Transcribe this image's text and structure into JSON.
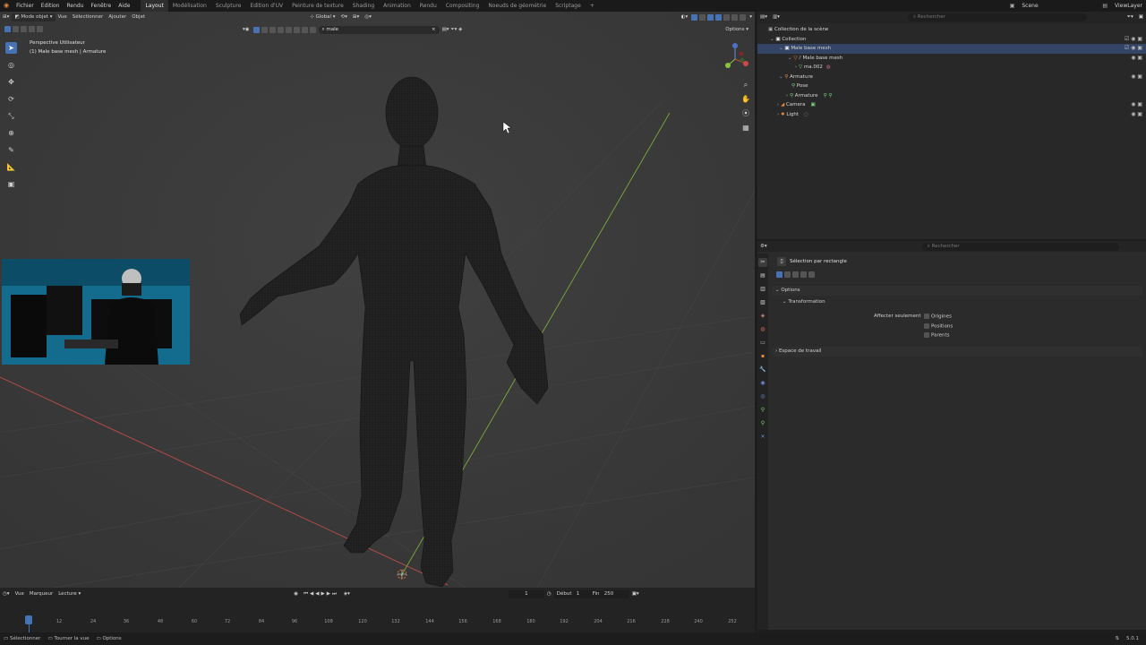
{
  "menu": {
    "items": [
      "Fichier",
      "Edition",
      "Rendu",
      "Fenêtre",
      "Aide"
    ],
    "workspaces": [
      "Layout",
      "Modélisation",
      "Sculpture",
      "Edition d'UV",
      "Peinture de texture",
      "Shading",
      "Animation",
      "Rendu",
      "Compositing",
      "Noeuds de géométrie",
      "Scriptage"
    ],
    "active_workspace": "Layout",
    "scene": "Scene",
    "view_layer": "ViewLayer"
  },
  "viewport": {
    "mode": "Mode objet",
    "menus": [
      "Vue",
      "Sélectionner",
      "Ajouter",
      "Objet"
    ],
    "orientation": "Global",
    "filter_value": "male",
    "options_label": "Options",
    "overlay_title": "Perspective Utilisateur",
    "overlay_subtitle": "(1) Male base mesh | Armature",
    "accent": "#4772b3",
    "x_axis_color": "#c94a4a",
    "y_axis_color": "#8cc43a"
  },
  "outliner": {
    "search_placeholder": "Rechercher",
    "rows": [
      {
        "label": "Collection de la scène"
      },
      {
        "label": "Collection"
      },
      {
        "label": "Male base mesh"
      },
      {
        "label": "Male base mesh"
      },
      {
        "label": "ma.002"
      },
      {
        "label": "Armature"
      },
      {
        "label": "Pose"
      },
      {
        "label": "Armature"
      },
      {
        "label": "Camera"
      },
      {
        "label": "Light"
      }
    ]
  },
  "properties": {
    "search_placeholder": "Rechercher",
    "tool_name": "Sélection par rectangle",
    "options_panel": "Options",
    "transform_panel": "Transformation",
    "affect_only_label": "Affecter seulement",
    "checkboxes": [
      "Origines",
      "Positions",
      "Parents"
    ],
    "workspace_panel": "Espace de travail"
  },
  "timeline": {
    "menus": [
      "Vue",
      "Marqueur",
      "Lecture"
    ],
    "current_frame": "1",
    "start_label": "Début",
    "start_value": "1",
    "end_label": "Fin",
    "end_value": "250",
    "ticks": [
      "1",
      "12",
      "24",
      "36",
      "48",
      "60",
      "72",
      "84",
      "96",
      "108",
      "120",
      "132",
      "144",
      "156",
      "168",
      "180",
      "192",
      "204",
      "216",
      "228",
      "240",
      "252"
    ]
  },
  "statusbar": {
    "items": [
      "Sélectionner",
      "Tourner la vue",
      "Options"
    ],
    "version": "5.0.1"
  }
}
